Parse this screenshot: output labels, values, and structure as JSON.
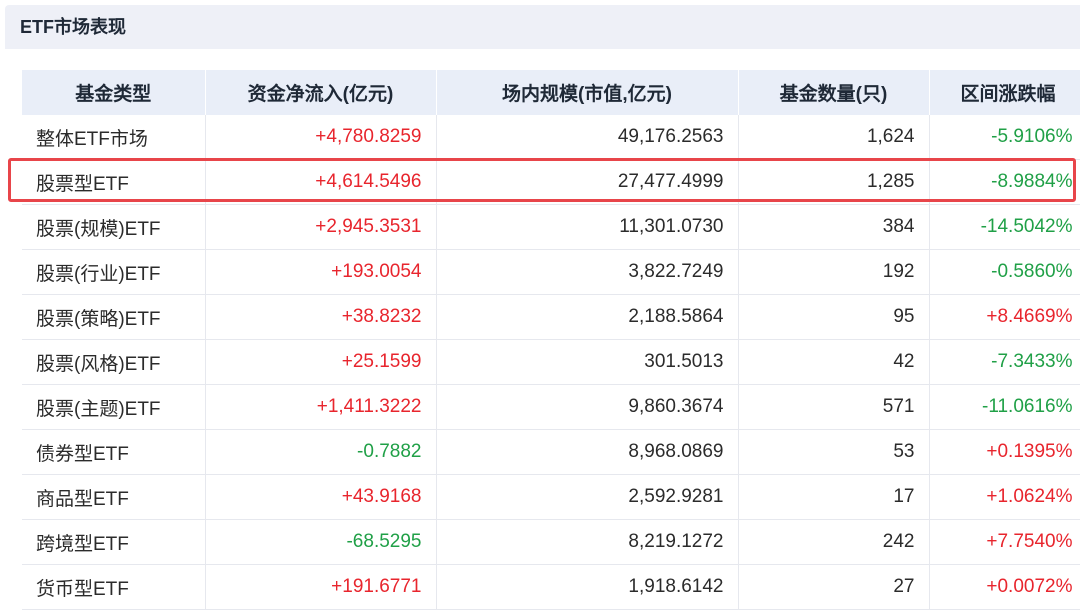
{
  "panel": {
    "title": "ETF市场表现"
  },
  "table": {
    "headers": [
      "基金类型",
      "资金净流入(亿元)",
      "场内规模(市值,亿元)",
      "基金数量(只)",
      "区间涨跌幅"
    ],
    "rows": [
      {
        "type": "整体ETF市场",
        "net_inflow": "+4,780.8259",
        "scale": "49,176.2563",
        "count": "1,624",
        "change": "-5.9106%"
      },
      {
        "type": "股票型ETF",
        "net_inflow": "+4,614.5496",
        "scale": "27,477.4999",
        "count": "1,285",
        "change": "-8.9884%"
      },
      {
        "type": "股票(规模)ETF",
        "net_inflow": "+2,945.3531",
        "scale": "11,301.0730",
        "count": "384",
        "change": "-14.5042%"
      },
      {
        "type": "股票(行业)ETF",
        "net_inflow": "+193.0054",
        "scale": "3,822.7249",
        "count": "192",
        "change": "-0.5860%"
      },
      {
        "type": "股票(策略)ETF",
        "net_inflow": "+38.8232",
        "scale": "2,188.5864",
        "count": "95",
        "change": "+8.4669%"
      },
      {
        "type": "股票(风格)ETF",
        "net_inflow": "+25.1599",
        "scale": "301.5013",
        "count": "42",
        "change": "-7.3433%"
      },
      {
        "type": "股票(主题)ETF",
        "net_inflow": "+1,411.3222",
        "scale": "9,860.3674",
        "count": "571",
        "change": "-11.0616%"
      },
      {
        "type": "债券型ETF",
        "net_inflow": "-0.7882",
        "scale": "8,968.0869",
        "count": "53",
        "change": "+0.1395%"
      },
      {
        "type": "商品型ETF",
        "net_inflow": "+43.9168",
        "scale": "2,592.9281",
        "count": "17",
        "change": "+1.0624%"
      },
      {
        "type": "跨境型ETF",
        "net_inflow": "-68.5295",
        "scale": "8,219.1272",
        "count": "242",
        "change": "+7.7540%"
      },
      {
        "type": "货币型ETF",
        "net_inflow": "+191.6771",
        "scale": "1,918.6142",
        "count": "27",
        "change": "+0.0072%"
      }
    ],
    "highlighted_row": 1
  },
  "colors": {
    "positive": "#e8252d",
    "negative": "#20a047",
    "header_bg": "#e9eef8",
    "highlight_border": "#e8454a"
  }
}
